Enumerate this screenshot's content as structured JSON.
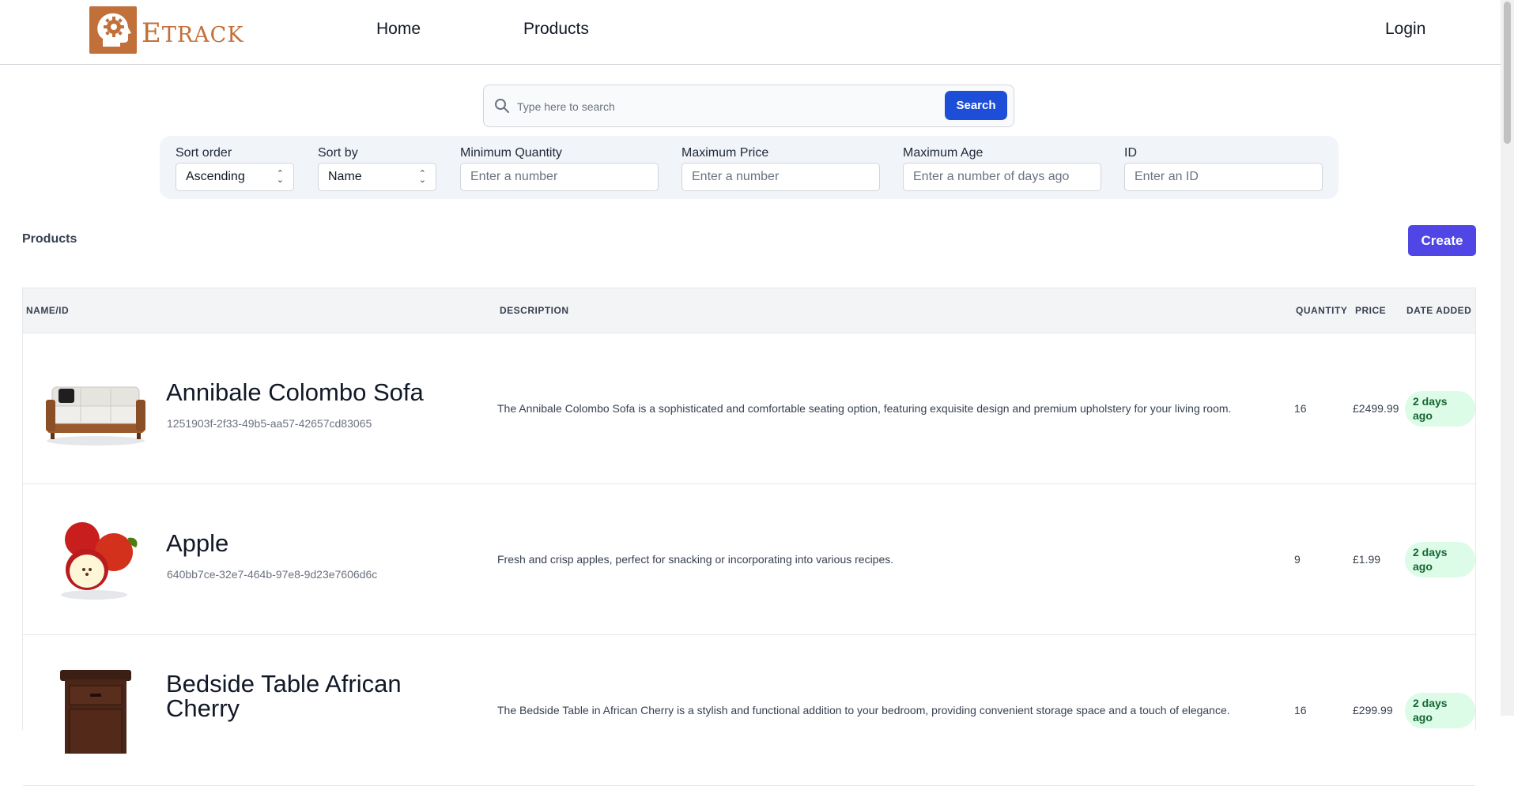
{
  "brand": {
    "name_first": "E",
    "name_rest": "TRACK",
    "accent": "#c2703a",
    "icon": "head-gear-icon"
  },
  "nav": {
    "home": "Home",
    "products": "Products",
    "login": "Login"
  },
  "search": {
    "placeholder": "Type here to search",
    "button": "Search",
    "icon": "search-icon",
    "button_color": "#1d4ed8"
  },
  "filters": {
    "sort_order": {
      "label": "Sort order",
      "value": "Ascending"
    },
    "sort_by": {
      "label": "Sort by",
      "value": "Name"
    },
    "min_quantity": {
      "label": "Minimum Quantity",
      "placeholder": "Enter a number"
    },
    "max_price": {
      "label": "Maximum Price",
      "placeholder": "Enter a number"
    },
    "max_age": {
      "label": "Maximum Age",
      "placeholder": "Enter a number of days ago"
    },
    "id": {
      "label": "ID",
      "placeholder": "Enter an ID"
    }
  },
  "products": {
    "title": "Products",
    "create_label": "Create",
    "create_color": "#4f46e5",
    "columns": {
      "name_id": "NAME/ID",
      "description": "DESCRIPTION",
      "quantity": "QUANTITY",
      "price": "PRICE",
      "date_added": "DATE ADDED"
    },
    "rows": [
      {
        "image": "sofa-image",
        "name": "Annibale Colombo Sofa",
        "id": "1251903f-2f33-49b5-aa57-42657cd83065",
        "description": "The Annibale Colombo Sofa is a sophisticated and comfortable seating option, featuring exquisite design and premium upholstery for your living room.",
        "quantity": "16",
        "price": "£2499.99",
        "date_added": "2 days ago"
      },
      {
        "image": "apple-image",
        "name": "Apple",
        "id": "640bb7ce-32e7-464b-97e8-9d23e7606d6c",
        "description": "Fresh and crisp apples, perfect for snacking or incorporating into various recipes.",
        "quantity": "9",
        "price": "£1.99",
        "date_added": "2 days ago"
      },
      {
        "image": "bedside-table-image",
        "name": "Bedside Table African Cherry",
        "id": "",
        "description": "The Bedside Table in African Cherry is a stylish and functional addition to your bedroom, providing convenient storage space and a touch of elegance.",
        "quantity": "16",
        "price": "£299.99",
        "date_added": "2 days ago"
      }
    ]
  }
}
